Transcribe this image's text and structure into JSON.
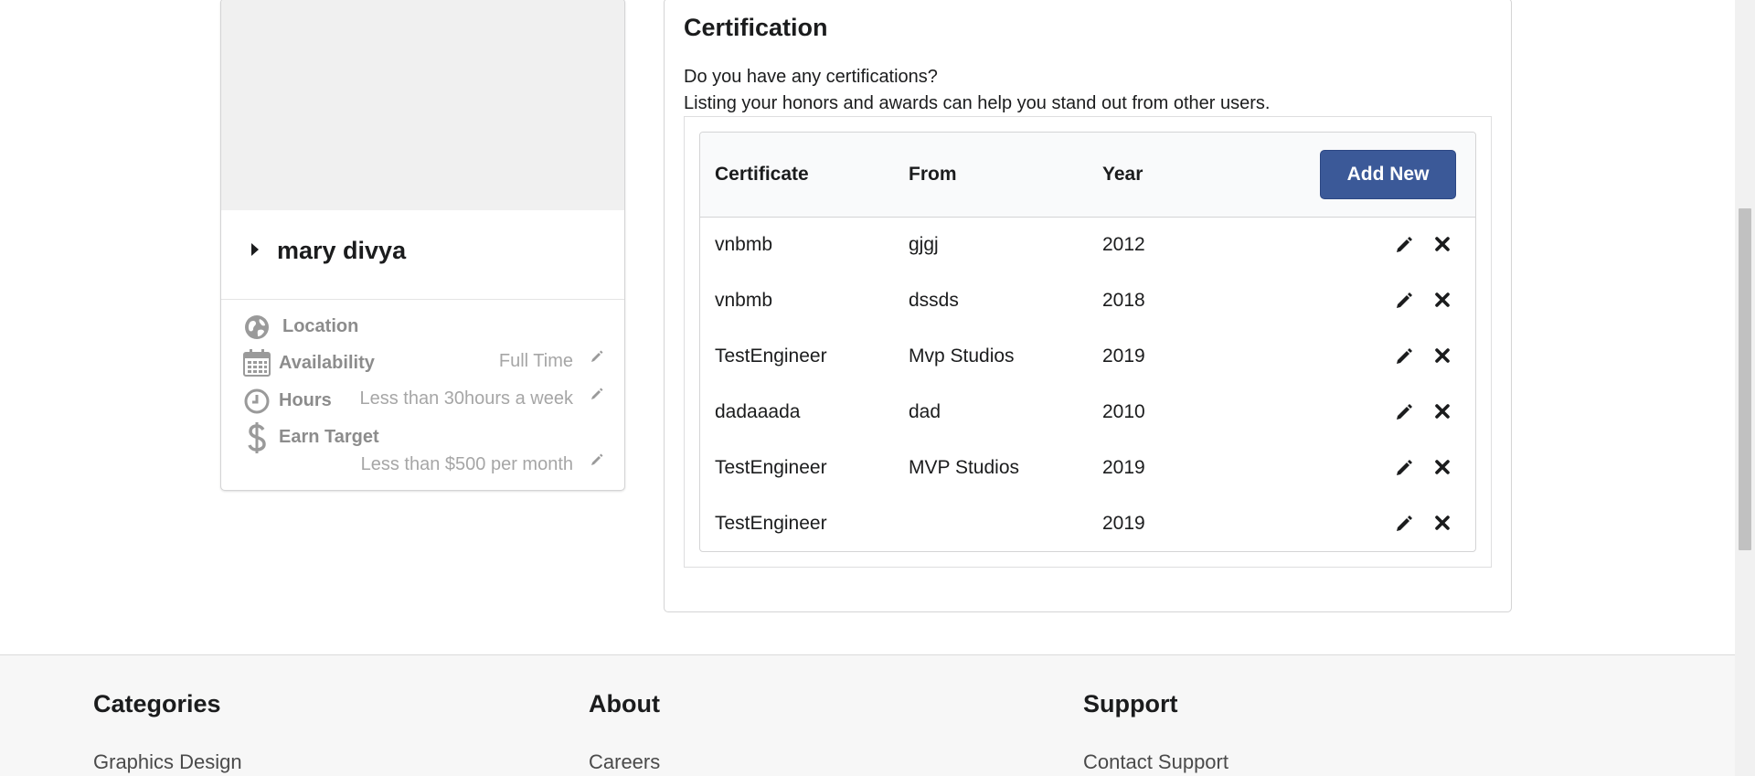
{
  "profile": {
    "name": "mary divya",
    "details": {
      "location_label": "Location",
      "availability_label": "Availability",
      "availability_value": "Full Time",
      "hours_label": "Hours",
      "hours_value": "Less than 30hours a week",
      "earn_target_label": "Earn Target",
      "earn_target_value": "Less than $500 per month"
    },
    "icons": [
      "globe-icon",
      "calendar-icon",
      "clock-icon",
      "dollar-icon",
      "pencil-icon"
    ]
  },
  "certification": {
    "title": "Certification",
    "question": "Do you have any certifications?",
    "description": "Listing your honors and awards can help you stand out from other users.",
    "columns": [
      "Certificate",
      "From",
      "Year"
    ],
    "add_new_label": "Add New",
    "rows": [
      {
        "certificate": "vnbmb",
        "from": "gjgj",
        "year": "2012"
      },
      {
        "certificate": "vnbmb",
        "from": "dssds",
        "year": "2018"
      },
      {
        "certificate": "TestEngineer",
        "from": "Mvp Studios",
        "year": "2019"
      },
      {
        "certificate": "dadaaada",
        "from": "dad",
        "year": "2010"
      },
      {
        "certificate": "TestEngineer",
        "from": "MVP Studios",
        "year": "2019"
      },
      {
        "certificate": "TestEngineer",
        "from": "",
        "year": "2019"
      }
    ],
    "row_icons": [
      "pencil-icon",
      "close-icon"
    ]
  },
  "footer": {
    "columns": [
      {
        "heading": "Categories",
        "first_link": "Graphics Design"
      },
      {
        "heading": "About",
        "first_link": "Careers"
      },
      {
        "heading": "Support",
        "first_link": "Contact Support"
      }
    ]
  },
  "colors": {
    "primary_button": "#3b5998",
    "muted_text": "#a6a6a6",
    "footer_bg": "#f7f7f7"
  }
}
